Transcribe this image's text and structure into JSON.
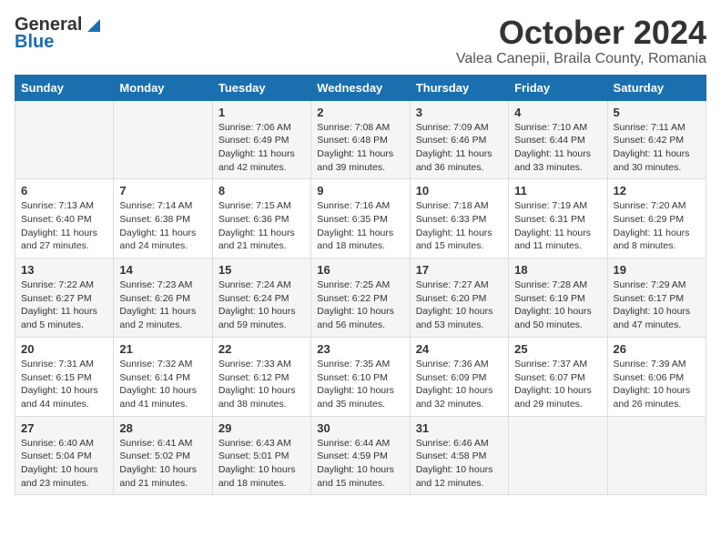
{
  "logo": {
    "general": "General",
    "blue": "Blue"
  },
  "title": "October 2024",
  "location": "Valea Canepii, Braila County, Romania",
  "days_of_week": [
    "Sunday",
    "Monday",
    "Tuesday",
    "Wednesday",
    "Thursday",
    "Friday",
    "Saturday"
  ],
  "weeks": [
    [
      {
        "day": "",
        "info": ""
      },
      {
        "day": "",
        "info": ""
      },
      {
        "day": "1",
        "info": "Sunrise: 7:06 AM\nSunset: 6:49 PM\nDaylight: 11 hours and 42 minutes."
      },
      {
        "day": "2",
        "info": "Sunrise: 7:08 AM\nSunset: 6:48 PM\nDaylight: 11 hours and 39 minutes."
      },
      {
        "day": "3",
        "info": "Sunrise: 7:09 AM\nSunset: 6:46 PM\nDaylight: 11 hours and 36 minutes."
      },
      {
        "day": "4",
        "info": "Sunrise: 7:10 AM\nSunset: 6:44 PM\nDaylight: 11 hours and 33 minutes."
      },
      {
        "day": "5",
        "info": "Sunrise: 7:11 AM\nSunset: 6:42 PM\nDaylight: 11 hours and 30 minutes."
      }
    ],
    [
      {
        "day": "6",
        "info": "Sunrise: 7:13 AM\nSunset: 6:40 PM\nDaylight: 11 hours and 27 minutes."
      },
      {
        "day": "7",
        "info": "Sunrise: 7:14 AM\nSunset: 6:38 PM\nDaylight: 11 hours and 24 minutes."
      },
      {
        "day": "8",
        "info": "Sunrise: 7:15 AM\nSunset: 6:36 PM\nDaylight: 11 hours and 21 minutes."
      },
      {
        "day": "9",
        "info": "Sunrise: 7:16 AM\nSunset: 6:35 PM\nDaylight: 11 hours and 18 minutes."
      },
      {
        "day": "10",
        "info": "Sunrise: 7:18 AM\nSunset: 6:33 PM\nDaylight: 11 hours and 15 minutes."
      },
      {
        "day": "11",
        "info": "Sunrise: 7:19 AM\nSunset: 6:31 PM\nDaylight: 11 hours and 11 minutes."
      },
      {
        "day": "12",
        "info": "Sunrise: 7:20 AM\nSunset: 6:29 PM\nDaylight: 11 hours and 8 minutes."
      }
    ],
    [
      {
        "day": "13",
        "info": "Sunrise: 7:22 AM\nSunset: 6:27 PM\nDaylight: 11 hours and 5 minutes."
      },
      {
        "day": "14",
        "info": "Sunrise: 7:23 AM\nSunset: 6:26 PM\nDaylight: 11 hours and 2 minutes."
      },
      {
        "day": "15",
        "info": "Sunrise: 7:24 AM\nSunset: 6:24 PM\nDaylight: 10 hours and 59 minutes."
      },
      {
        "day": "16",
        "info": "Sunrise: 7:25 AM\nSunset: 6:22 PM\nDaylight: 10 hours and 56 minutes."
      },
      {
        "day": "17",
        "info": "Sunrise: 7:27 AM\nSunset: 6:20 PM\nDaylight: 10 hours and 53 minutes."
      },
      {
        "day": "18",
        "info": "Sunrise: 7:28 AM\nSunset: 6:19 PM\nDaylight: 10 hours and 50 minutes."
      },
      {
        "day": "19",
        "info": "Sunrise: 7:29 AM\nSunset: 6:17 PM\nDaylight: 10 hours and 47 minutes."
      }
    ],
    [
      {
        "day": "20",
        "info": "Sunrise: 7:31 AM\nSunset: 6:15 PM\nDaylight: 10 hours and 44 minutes."
      },
      {
        "day": "21",
        "info": "Sunrise: 7:32 AM\nSunset: 6:14 PM\nDaylight: 10 hours and 41 minutes."
      },
      {
        "day": "22",
        "info": "Sunrise: 7:33 AM\nSunset: 6:12 PM\nDaylight: 10 hours and 38 minutes."
      },
      {
        "day": "23",
        "info": "Sunrise: 7:35 AM\nSunset: 6:10 PM\nDaylight: 10 hours and 35 minutes."
      },
      {
        "day": "24",
        "info": "Sunrise: 7:36 AM\nSunset: 6:09 PM\nDaylight: 10 hours and 32 minutes."
      },
      {
        "day": "25",
        "info": "Sunrise: 7:37 AM\nSunset: 6:07 PM\nDaylight: 10 hours and 29 minutes."
      },
      {
        "day": "26",
        "info": "Sunrise: 7:39 AM\nSunset: 6:06 PM\nDaylight: 10 hours and 26 minutes."
      }
    ],
    [
      {
        "day": "27",
        "info": "Sunrise: 6:40 AM\nSunset: 5:04 PM\nDaylight: 10 hours and 23 minutes."
      },
      {
        "day": "28",
        "info": "Sunrise: 6:41 AM\nSunset: 5:02 PM\nDaylight: 10 hours and 21 minutes."
      },
      {
        "day": "29",
        "info": "Sunrise: 6:43 AM\nSunset: 5:01 PM\nDaylight: 10 hours and 18 minutes."
      },
      {
        "day": "30",
        "info": "Sunrise: 6:44 AM\nSunset: 4:59 PM\nDaylight: 10 hours and 15 minutes."
      },
      {
        "day": "31",
        "info": "Sunrise: 6:46 AM\nSunset: 4:58 PM\nDaylight: 10 hours and 12 minutes."
      },
      {
        "day": "",
        "info": ""
      },
      {
        "day": "",
        "info": ""
      }
    ]
  ]
}
